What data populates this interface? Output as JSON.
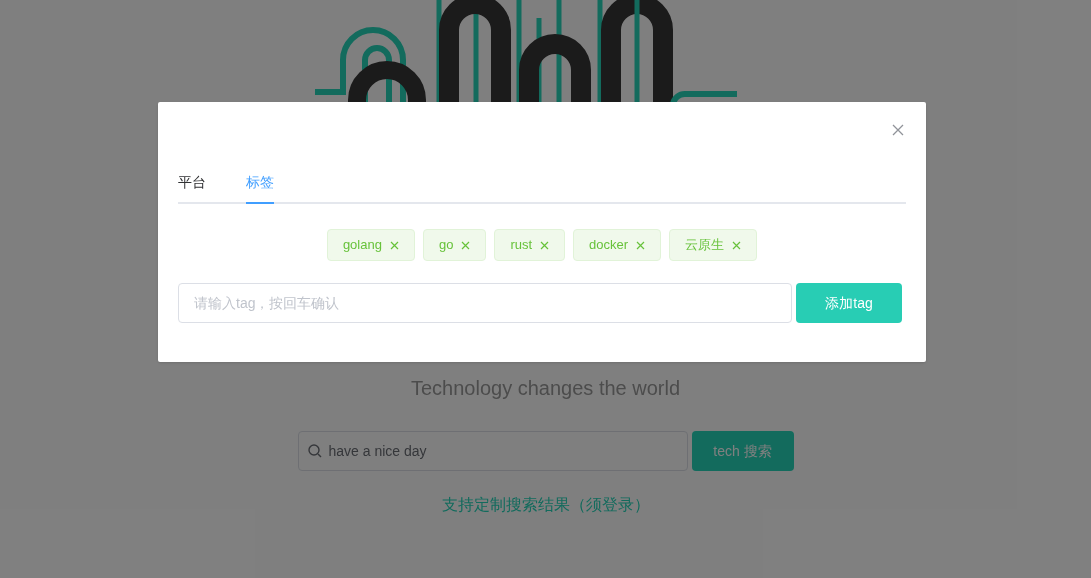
{
  "page": {
    "tagline": "Technology changes the world",
    "search": {
      "placeholder": "have a nice day"
    },
    "search_button": "tech 搜索",
    "custom_link": "支持定制搜索结果（须登录）"
  },
  "dialog": {
    "tabs": [
      {
        "label": "平台",
        "selected": false
      },
      {
        "label": "标签",
        "selected": true
      }
    ],
    "tags": [
      {
        "label": "golang"
      },
      {
        "label": "go"
      },
      {
        "label": "rust"
      },
      {
        "label": "docker"
      },
      {
        "label": "云原生"
      }
    ],
    "tag_input": {
      "placeholder": "请输入tag，按回车确认"
    },
    "add_button": "添加tag"
  }
}
